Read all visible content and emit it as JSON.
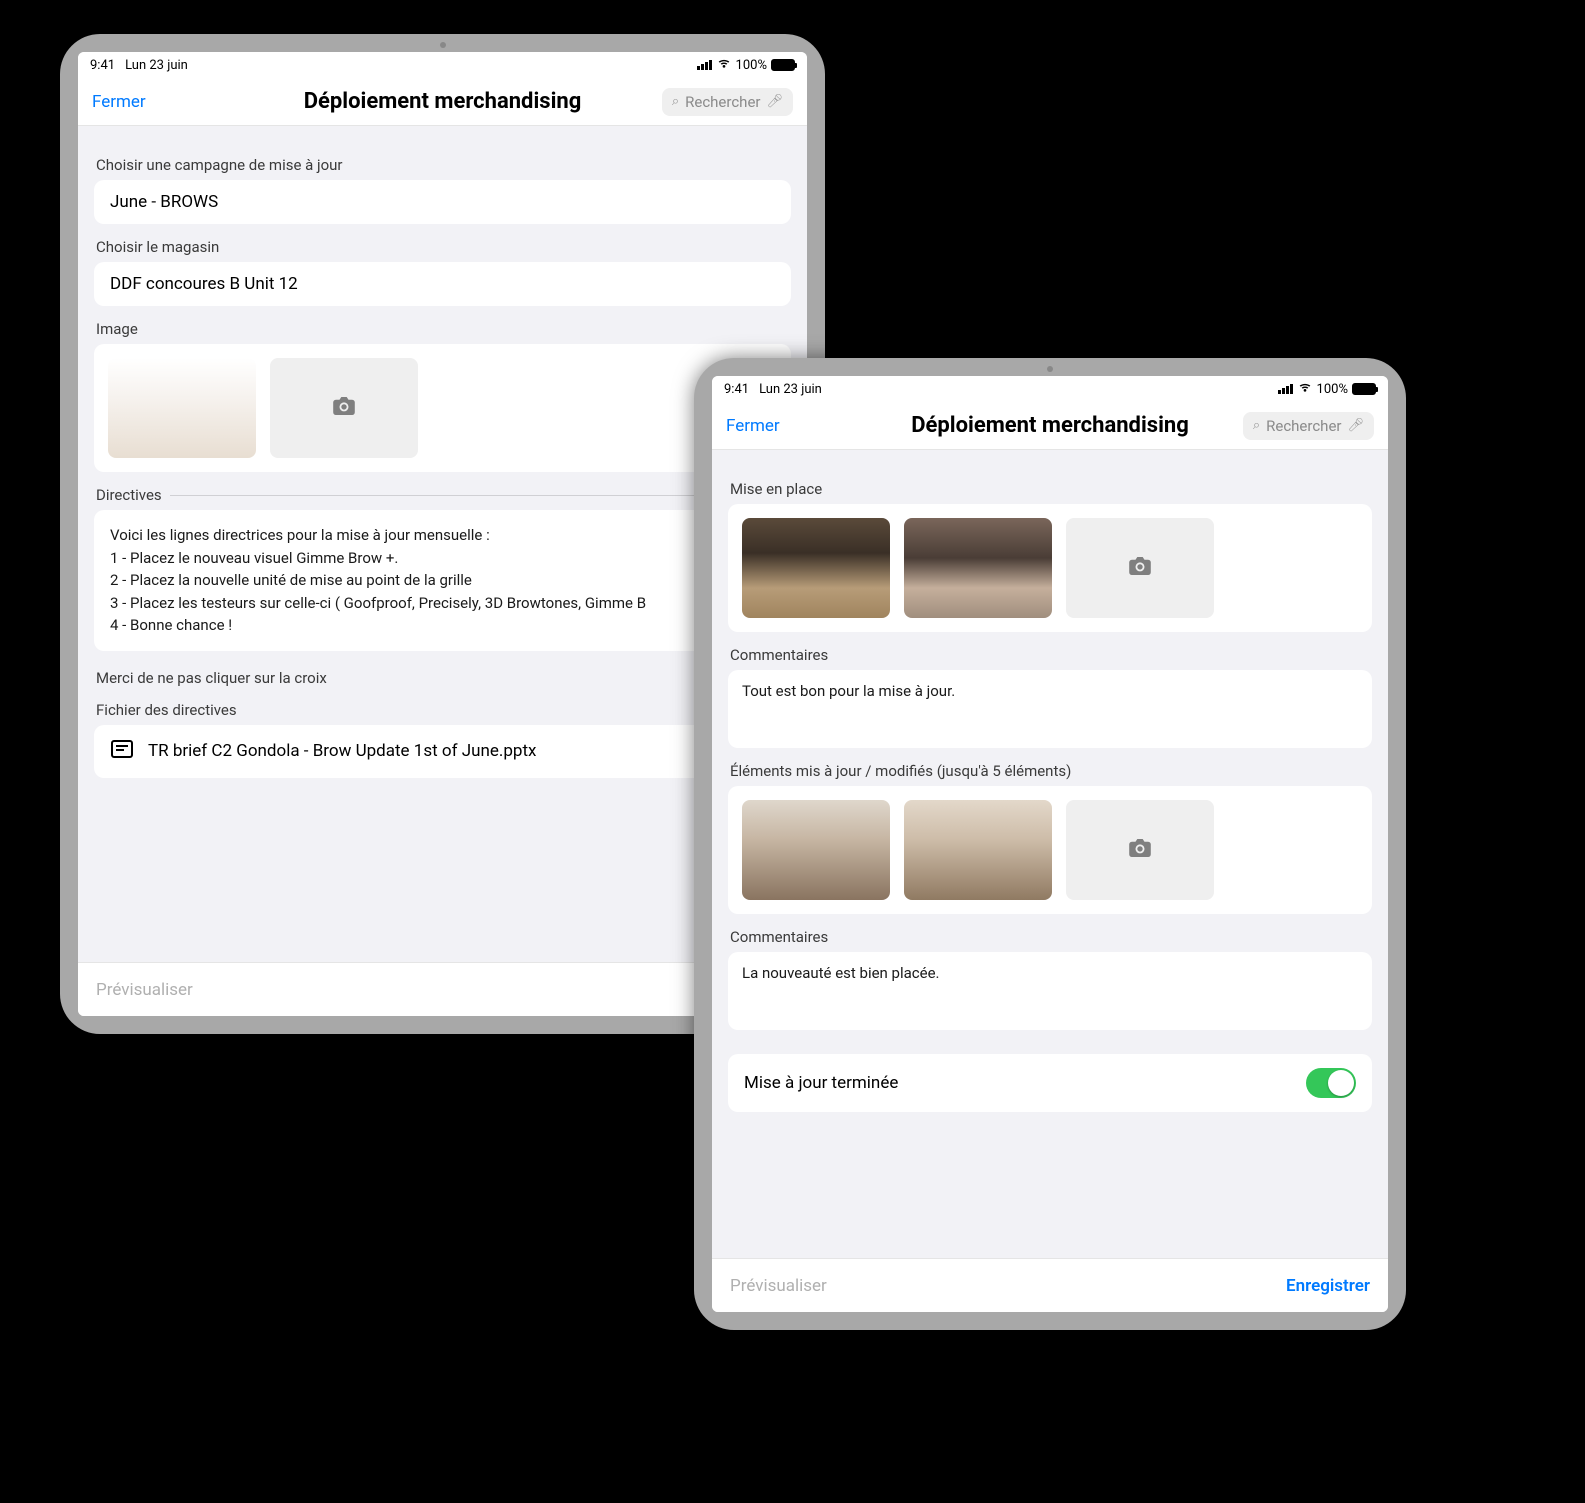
{
  "status": {
    "time": "9:41",
    "date": "Lun 23 juin",
    "battery_pct": "100%"
  },
  "nav": {
    "close": "Fermer",
    "title": "Déploiement merchandising",
    "search_placeholder": "Rechercher"
  },
  "screen1": {
    "campaign_label": "Choisir une campagne de mise à jour",
    "campaign_value": "June - BROWS",
    "store_label": "Choisir le magasin",
    "store_value": "DDF concoures B Unit 12",
    "image_label": "Image",
    "directives_label": "Directives",
    "directives_body": "Voici les lignes directrices pour la mise à jour mensuelle :\n1 - Placez le nouveau visuel Gimme Brow +.\n2 - Placez la nouvelle unité de mise au point de la grille\n3 - Placez les testeurs sur celle-ci ( Goofproof, Precisely, 3D Browtones, Gimme B\n4 - Bonne chance !",
    "no_cross_note": "Merci de ne pas cliquer sur la croix",
    "file_label": "Fichier des directives",
    "file_name": "TR brief C2 Gondola - Brow Update 1st of June.pptx"
  },
  "screen2": {
    "setup_label": "Mise en place",
    "comments_label": "Commentaires",
    "comment1": "Tout est bon pour la mise à jour.",
    "updated_label": "Éléments mis à jour / modifiés (jusqu'à 5 éléments)",
    "comments_label2": "Commentaires",
    "comment2": "La nouveauté est bien placée.",
    "complete_label": "Mise à jour terminée"
  },
  "footer": {
    "preview": "Prévisualiser",
    "save": "Enregistrer"
  }
}
